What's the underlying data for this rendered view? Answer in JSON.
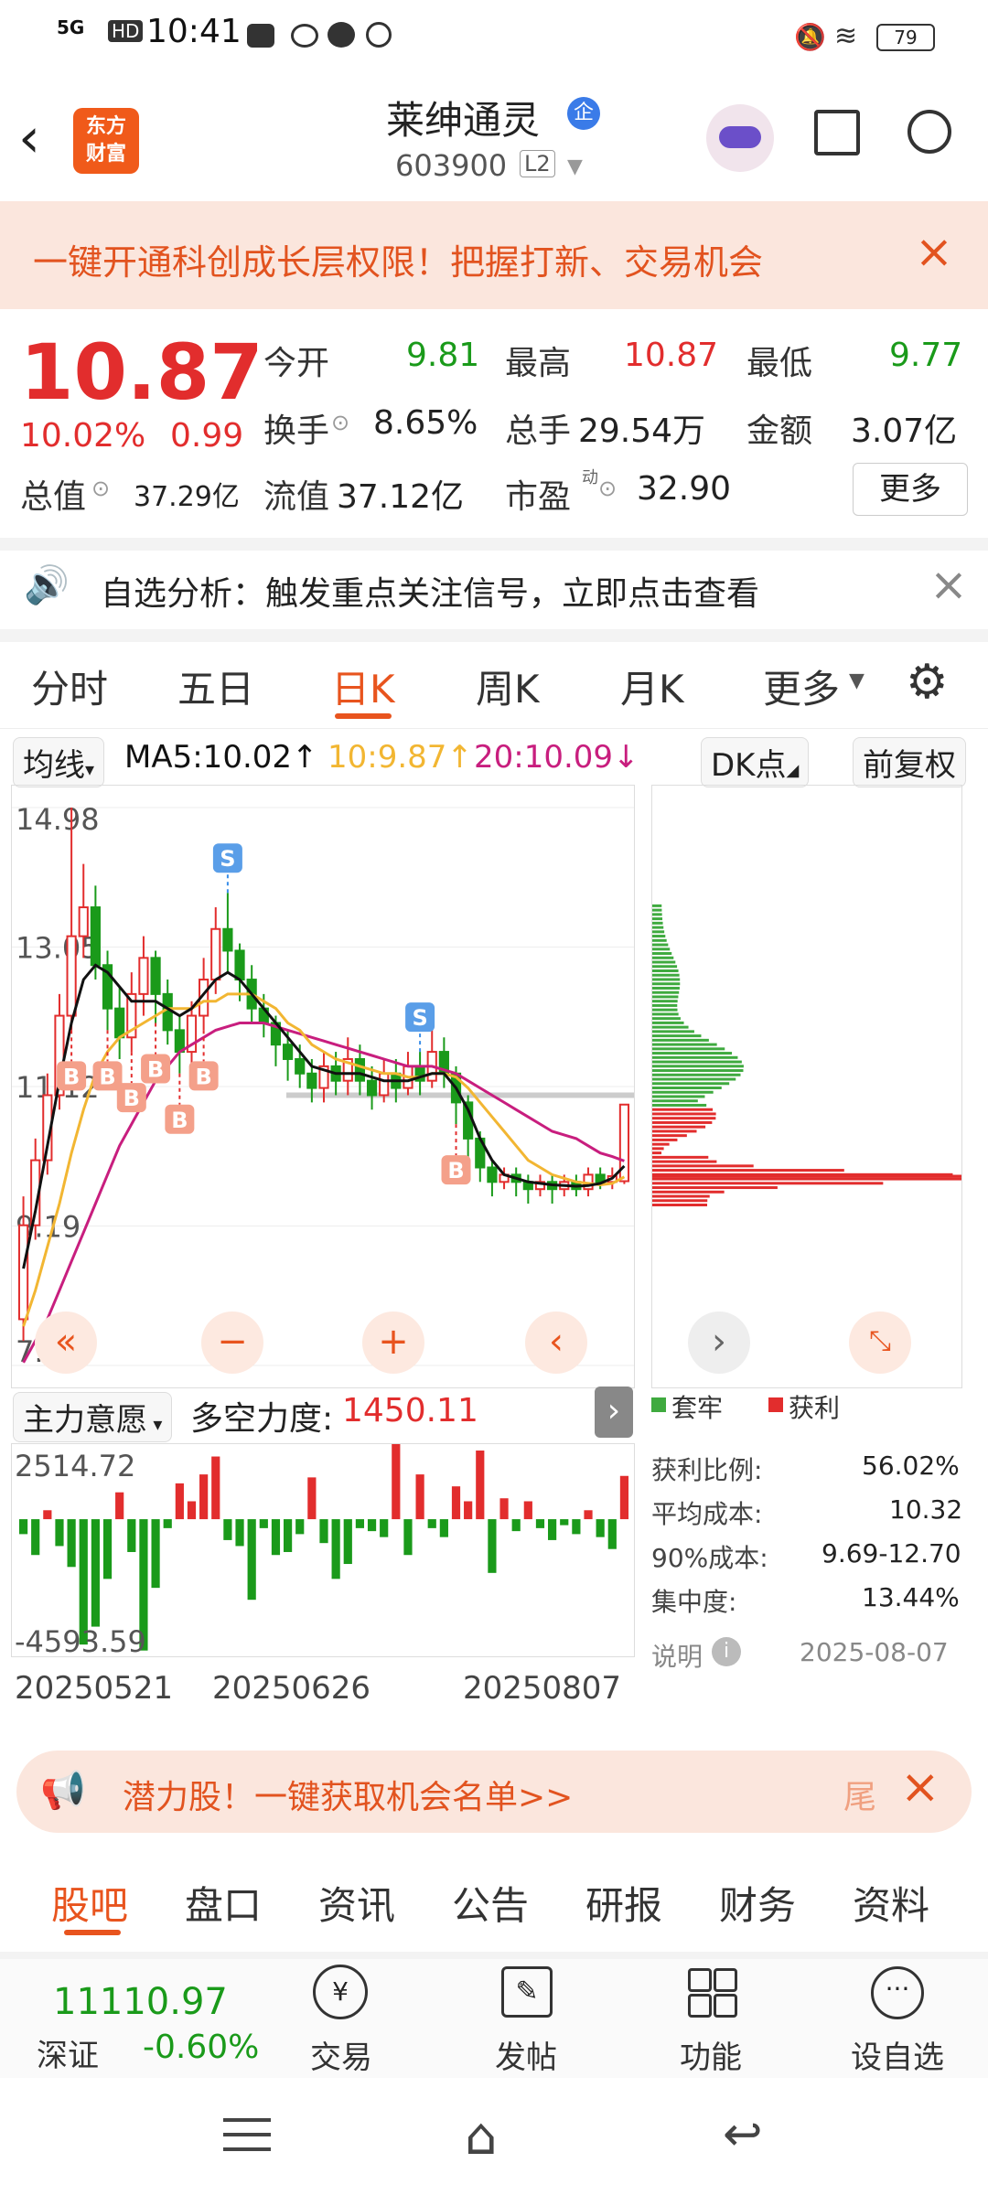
{
  "status_bar": {
    "network": "5G",
    "hd": "HD",
    "time": "10:41",
    "battery": "79"
  },
  "header": {
    "logo_line1": "东方",
    "logo_line2": "财富",
    "stock_name": "莱绅通灵",
    "badge": "企",
    "code": "603900",
    "level": "L2"
  },
  "banner": {
    "text": "一键开通科创成长层权限！把握打新、交易机会"
  },
  "quote": {
    "price": "10.87",
    "pct": "10.02%",
    "change": "0.99",
    "open_label": "今开",
    "open": "9.81",
    "high_label": "最高",
    "high": "10.87",
    "low_label": "最低",
    "low": "9.77",
    "turnover_label": "换手",
    "turnover": "8.65%",
    "volume_label": "总手",
    "volume": "29.54万",
    "amount_label": "金额",
    "amount": "3.07亿",
    "mktcap_label": "总值",
    "mktcap": "37.29亿",
    "float_label": "流值",
    "float": "37.12亿",
    "pe_label": "市盈",
    "pe_sup": "动",
    "pe": "32.90",
    "more": "更多"
  },
  "alert": {
    "text": "自选分析：触发重点关注信号，立即点击查看"
  },
  "chart_tabs": [
    "分时",
    "五日",
    "日K",
    "周K",
    "月K",
    "更多"
  ],
  "ma_bar": {
    "selector": "均线",
    "ma5": "MA5:10.02",
    "ma10": "10:9.87",
    "ma20": "20:10.09",
    "dk": "DK点",
    "adj": "前复权"
  },
  "colors": {
    "accent": "#e8541e",
    "up": "#e22d2d",
    "down": "#1a9a1a",
    "ma5": "#111111",
    "ma10": "#f2b632",
    "ma20": "#c81e7e"
  },
  "chart_data": {
    "type": "candlestick",
    "y_ticks": [
      "14.98",
      "13.05",
      "11.12",
      "9.19",
      "7.26"
    ],
    "ylim": [
      7.26,
      14.98
    ],
    "x_ticks": [
      "20250521",
      "20250626",
      "20250807"
    ],
    "candles": [
      [
        7.9,
        9.2,
        9.6,
        7.6
      ],
      [
        9.2,
        10.1,
        10.4,
        9.0
      ],
      [
        10.1,
        11.0,
        11.3,
        9.9
      ],
      [
        11.0,
        12.1,
        12.4,
        10.8
      ],
      [
        12.1,
        13.2,
        14.98,
        11.9
      ],
      [
        13.2,
        13.6,
        14.2,
        12.9
      ],
      [
        13.6,
        12.8,
        13.9,
        12.6
      ],
      [
        12.8,
        12.2,
        13.0,
        11.9
      ],
      [
        12.2,
        11.8,
        12.5,
        11.5
      ],
      [
        11.8,
        12.4,
        12.7,
        11.6
      ],
      [
        12.4,
        12.9,
        13.2,
        12.1
      ],
      [
        12.9,
        12.4,
        13.0,
        12.0
      ],
      [
        12.4,
        11.9,
        12.6,
        11.7
      ],
      [
        11.9,
        11.6,
        12.1,
        11.3
      ],
      [
        11.6,
        12.1,
        12.3,
        11.4
      ],
      [
        12.1,
        12.6,
        12.9,
        11.9
      ],
      [
        12.6,
        13.3,
        13.6,
        12.4
      ],
      [
        13.3,
        13.0,
        13.8,
        12.7
      ],
      [
        13.0,
        12.6,
        13.1,
        12.3
      ],
      [
        12.6,
        12.2,
        12.8,
        12.0
      ],
      [
        12.2,
        12.0,
        12.4,
        11.8
      ],
      [
        12.0,
        11.7,
        12.1,
        11.4
      ],
      [
        11.7,
        11.5,
        11.9,
        11.2
      ],
      [
        11.5,
        11.3,
        11.7,
        11.1
      ],
      [
        11.3,
        11.1,
        11.5,
        10.9
      ],
      [
        11.1,
        11.4,
        11.6,
        10.9
      ],
      [
        11.4,
        11.2,
        11.6,
        11.0
      ],
      [
        11.2,
        11.5,
        11.8,
        11.0
      ],
      [
        11.5,
        11.2,
        11.7,
        11.0
      ],
      [
        11.2,
        11.0,
        11.4,
        10.8
      ],
      [
        11.0,
        11.3,
        11.5,
        10.9
      ],
      [
        11.3,
        11.1,
        11.5,
        10.9
      ],
      [
        11.1,
        11.4,
        11.6,
        11.0
      ],
      [
        11.4,
        11.2,
        11.6,
        11.0
      ],
      [
        11.2,
        11.6,
        11.9,
        11.1
      ],
      [
        11.6,
        11.3,
        11.8,
        11.1
      ],
      [
        11.3,
        10.9,
        11.4,
        10.6
      ],
      [
        10.9,
        10.4,
        11.0,
        10.1
      ],
      [
        10.4,
        10.0,
        10.5,
        9.8
      ],
      [
        10.0,
        9.8,
        10.1,
        9.6
      ],
      [
        9.8,
        9.9,
        10.0,
        9.7
      ],
      [
        9.9,
        9.8,
        10.0,
        9.6
      ],
      [
        9.8,
        9.7,
        9.9,
        9.5
      ],
      [
        9.7,
        9.8,
        9.9,
        9.6
      ],
      [
        9.8,
        9.7,
        9.9,
        9.5
      ],
      [
        9.7,
        9.8,
        9.9,
        9.6
      ],
      [
        9.8,
        9.7,
        9.9,
        9.6
      ],
      [
        9.7,
        9.9,
        10.0,
        9.6
      ],
      [
        9.9,
        9.8,
        10.0,
        9.7
      ],
      [
        9.8,
        9.88,
        10.0,
        9.7
      ],
      [
        9.81,
        10.87,
        10.87,
        9.77
      ]
    ],
    "ma5": [
      8.6,
      9.4,
      10.3,
      11.2,
      12.0,
      12.6,
      12.8,
      12.7,
      12.5,
      12.3,
      12.3,
      12.3,
      12.2,
      12.1,
      12.2,
      12.4,
      12.6,
      12.7,
      12.6,
      12.4,
      12.2,
      12.0,
      11.8,
      11.6,
      11.4,
      11.35,
      11.3,
      11.3,
      11.3,
      11.25,
      11.2,
      11.2,
      11.2,
      11.25,
      11.3,
      11.3,
      11.1,
      10.8,
      10.4,
      10.1,
      9.9,
      9.85,
      9.8,
      9.78,
      9.76,
      9.75,
      9.74,
      9.75,
      9.78,
      9.85,
      10.02
    ],
    "ma10": [
      7.8,
      8.3,
      8.9,
      9.5,
      10.2,
      10.8,
      11.3,
      11.6,
      11.8,
      11.9,
      12.0,
      12.1,
      12.2,
      12.2,
      12.2,
      12.3,
      12.3,
      12.4,
      12.4,
      12.4,
      12.3,
      12.2,
      12.0,
      11.9,
      11.7,
      11.6,
      11.5,
      11.45,
      11.4,
      11.35,
      11.3,
      11.3,
      11.25,
      11.25,
      11.3,
      11.3,
      11.25,
      11.1,
      10.9,
      10.7,
      10.5,
      10.3,
      10.1,
      10.0,
      9.9,
      9.85,
      9.8,
      9.78,
      9.76,
      9.78,
      9.87
    ],
    "ma20": [
      7.3,
      7.6,
      7.9,
      8.3,
      8.7,
      9.1,
      9.5,
      9.9,
      10.3,
      10.6,
      10.9,
      11.2,
      11.4,
      11.6,
      11.7,
      11.8,
      11.9,
      11.95,
      12.0,
      12.0,
      12.0,
      11.95,
      11.9,
      11.85,
      11.8,
      11.75,
      11.7,
      11.65,
      11.6,
      11.55,
      11.5,
      11.45,
      11.4,
      11.4,
      11.4,
      11.35,
      11.3,
      11.2,
      11.1,
      11.0,
      10.9,
      10.8,
      10.7,
      10.6,
      10.5,
      10.45,
      10.4,
      10.3,
      10.2,
      10.15,
      10.09
    ],
    "signals": [
      {
        "label": "B",
        "i": 4
      },
      {
        "label": "B",
        "i": 7
      },
      {
        "label": "B",
        "i": 9
      },
      {
        "label": "B",
        "i": 11
      },
      {
        "label": "B",
        "i": 13
      },
      {
        "label": "B",
        "i": 15
      },
      {
        "label": "S",
        "i": 17
      },
      {
        "label": "S",
        "i": 33
      },
      {
        "label": "B",
        "i": 36
      }
    ]
  },
  "indicator": {
    "selector": "主力意愿",
    "label": "多空力度:",
    "value": "1450.11",
    "top": "2514.72",
    "bottom": "-4593.59"
  },
  "indicator_data": [
    -500,
    -1200,
    300,
    -900,
    -1600,
    -4200,
    -3600,
    -2000,
    900,
    -1100,
    -4400,
    -2300,
    -300,
    1200,
    600,
    1500,
    2100,
    -700,
    -900,
    -2700,
    -300,
    -1200,
    -1100,
    -500,
    1400,
    -800,
    -2000,
    -1500,
    -300,
    -400,
    -600,
    2800,
    -1200,
    1500,
    -300,
    -600,
    1100,
    600,
    2300,
    -1800,
    700,
    -400,
    600,
    -300,
    -700,
    -200,
    -500,
    300,
    -600,
    -1000,
    1450
  ],
  "distribution": {
    "legend_loss": "套牢",
    "legend_profit": "获利",
    "rows": [
      {
        "label": "获利比例:",
        "value": "56.02%"
      },
      {
        "label": "平均成本:",
        "value": "10.32"
      },
      {
        "label": "90%成本:",
        "value": "9.69-12.70"
      },
      {
        "label": "集中度:",
        "value": "13.44%"
      }
    ],
    "note": "说明",
    "date": "2025-08-07"
  },
  "promo": {
    "text": "潜力股！一键获取机会名单>>",
    "tail": "尾"
  },
  "bottom_tabs": [
    "股吧",
    "盘口",
    "资讯",
    "公告",
    "研报",
    "财务",
    "资料"
  ],
  "index": {
    "value": "11110.97",
    "name": "深证",
    "change": "-0.60%"
  },
  "bottom_nav": [
    {
      "label": "交易",
      "icon": "trade-icon"
    },
    {
      "label": "发帖",
      "icon": "edit-icon"
    },
    {
      "label": "功能",
      "icon": "grid-icon"
    },
    {
      "label": "设自选",
      "icon": "more-icon"
    }
  ]
}
